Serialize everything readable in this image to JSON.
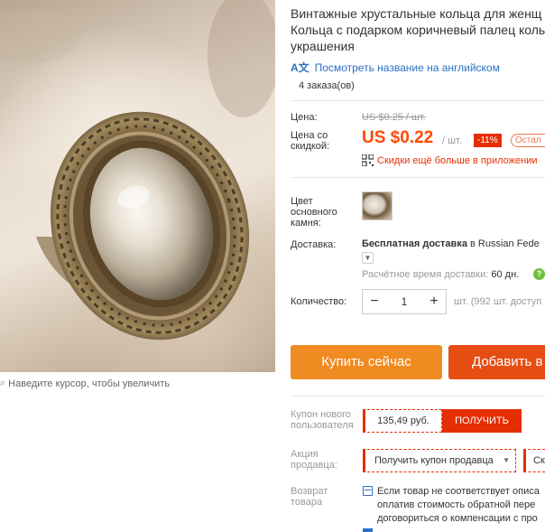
{
  "product": {
    "title_line1": "Винтажные хрустальные кольца для женщ",
    "title_line2": "Кольца с подарком коричневый палец коль",
    "title_line3": "украшения",
    "translate_link": "Посмотреть название на английском",
    "orders": "4 заказа(ов)"
  },
  "gallery": {
    "zoom_hint": "Наведите курсор, чтобы увеличить"
  },
  "pricing": {
    "price_label": "Цена:",
    "old_price": "US $0.25 / шт.",
    "discount_price_label": "Цена со скидкой:",
    "price": "US $0.22",
    "per_unit": "/ шт.",
    "discount_badge": "-11%",
    "remaining_badge": "Остал",
    "app_promo": "Скидки ещё больше в приложении"
  },
  "options": {
    "stone_color_label": "Цвет основного камня:"
  },
  "shipping": {
    "label": "Доставка:",
    "method_bold": "Бесплатная доставка",
    "method_rest": " в Russian Fede",
    "delivery_label": "Расчётное время доставки:",
    "delivery_value": " 60 дн."
  },
  "quantity": {
    "label": "Количество:",
    "minus": "−",
    "value": "1",
    "plus": "+",
    "stock_note": "шт. (992 шт. доступ"
  },
  "actions": {
    "buy_now": "Купить сейчас",
    "add_to_cart": "Добавить в"
  },
  "coupons": {
    "new_user_label": "Купон нового пользователя",
    "new_user_amount": "135,49 руб.",
    "get_button": "ПОЛУЧИТЬ",
    "seller_label": "Акция продавца:",
    "seller_coupon": "Получить купон продавца",
    "seller_coupon_2": "Ск"
  },
  "returns": {
    "label": "Возврат товара",
    "line1": "Если товар не соответствует описа",
    "line2": "оплатив стоимость обратной пере",
    "line3": "договориться о компенсации с про"
  },
  "colors": {
    "accent_orange": "#f08b21",
    "cart_red": "#e64d13",
    "price_orange": "#ff4a00",
    "badge_red": "#e62e04",
    "link_blue": "#2a6fc4"
  }
}
